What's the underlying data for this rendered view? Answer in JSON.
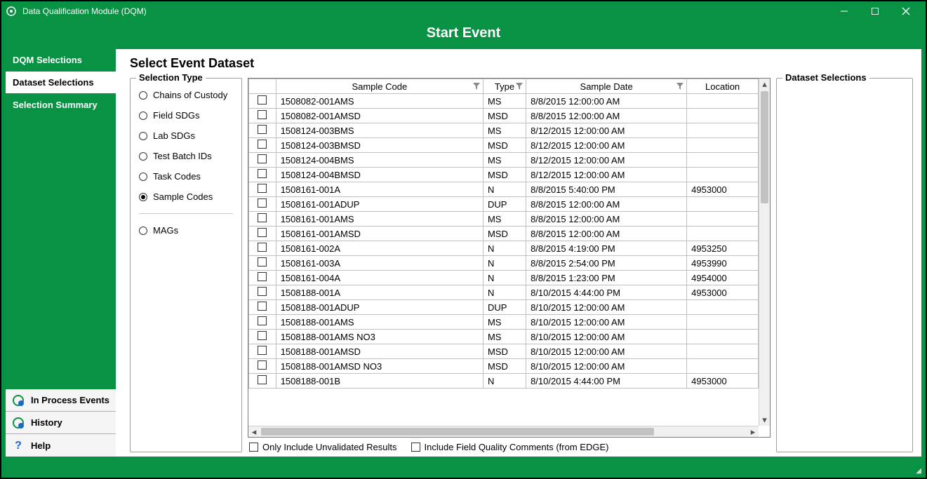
{
  "window": {
    "title": "Data Qualification Module (DQM)"
  },
  "heading": "Start Event",
  "sidebar": {
    "top": [
      {
        "label": "DQM Selections",
        "active": false
      },
      {
        "label": "Dataset Selections",
        "active": true
      },
      {
        "label": "Selection Summary",
        "active": false
      }
    ],
    "bottom": [
      {
        "label": "In Process Events",
        "icon": "events-icon"
      },
      {
        "label": "History",
        "icon": "history-icon"
      },
      {
        "label": "Help",
        "icon": "help-icon"
      }
    ]
  },
  "page_title": "Select Event Dataset",
  "selection_type": {
    "legend": "Selection Type",
    "groups": [
      [
        {
          "label": "Chains of Custody",
          "selected": false
        },
        {
          "label": "Field SDGs",
          "selected": false
        },
        {
          "label": "Lab SDGs",
          "selected": false
        },
        {
          "label": "Test Batch IDs",
          "selected": false
        },
        {
          "label": "Task Codes",
          "selected": false
        },
        {
          "label": "Sample Codes",
          "selected": true
        }
      ],
      [
        {
          "label": "MAGs",
          "selected": false
        }
      ]
    ]
  },
  "grid": {
    "columns": [
      {
        "key": "check",
        "label": "",
        "filter": false
      },
      {
        "key": "code",
        "label": "Sample Code",
        "filter": true
      },
      {
        "key": "type",
        "label": "Type",
        "filter": true
      },
      {
        "key": "date",
        "label": "Sample Date",
        "filter": true
      },
      {
        "key": "loc",
        "label": "Location",
        "filter": false
      }
    ],
    "rows": [
      {
        "code": "1508082-001AMS",
        "type": "MS",
        "date": "8/8/2015 12:00:00 AM",
        "loc": ""
      },
      {
        "code": "1508082-001AMSD",
        "type": "MSD",
        "date": "8/8/2015 12:00:00 AM",
        "loc": ""
      },
      {
        "code": "1508124-003BMS",
        "type": "MS",
        "date": "8/12/2015 12:00:00 AM",
        "loc": ""
      },
      {
        "code": "1508124-003BMSD",
        "type": "MSD",
        "date": "8/12/2015 12:00:00 AM",
        "loc": ""
      },
      {
        "code": "1508124-004BMS",
        "type": "MS",
        "date": "8/12/2015 12:00:00 AM",
        "loc": ""
      },
      {
        "code": "1508124-004BMSD",
        "type": "MSD",
        "date": "8/12/2015 12:00:00 AM",
        "loc": ""
      },
      {
        "code": "1508161-001A",
        "type": "N",
        "date": "8/8/2015 5:40:00 PM",
        "loc": "4953000"
      },
      {
        "code": "1508161-001ADUP",
        "type": "DUP",
        "date": "8/8/2015 12:00:00 AM",
        "loc": ""
      },
      {
        "code": "1508161-001AMS",
        "type": "MS",
        "date": "8/8/2015 12:00:00 AM",
        "loc": ""
      },
      {
        "code": "1508161-001AMSD",
        "type": "MSD",
        "date": "8/8/2015 12:00:00 AM",
        "loc": ""
      },
      {
        "code": "1508161-002A",
        "type": "N",
        "date": "8/8/2015 4:19:00 PM",
        "loc": "4953250"
      },
      {
        "code": "1508161-003A",
        "type": "N",
        "date": "8/8/2015 2:54:00 PM",
        "loc": "4953990"
      },
      {
        "code": "1508161-004A",
        "type": "N",
        "date": "8/8/2015 1:23:00 PM",
        "loc": "4954000"
      },
      {
        "code": "1508188-001A",
        "type": "N",
        "date": "8/10/2015 4:44:00 PM",
        "loc": "4953000"
      },
      {
        "code": "1508188-001ADUP",
        "type": "DUP",
        "date": "8/10/2015 12:00:00 AM",
        "loc": ""
      },
      {
        "code": "1508188-001AMS",
        "type": "MS",
        "date": "8/10/2015 12:00:00 AM",
        "loc": ""
      },
      {
        "code": "1508188-001AMS NO3",
        "type": "MS",
        "date": "8/10/2015 12:00:00 AM",
        "loc": ""
      },
      {
        "code": "1508188-001AMSD",
        "type": "MSD",
        "date": "8/10/2015 12:00:00 AM",
        "loc": ""
      },
      {
        "code": "1508188-001AMSD NO3",
        "type": "MSD",
        "date": "8/10/2015 12:00:00 AM",
        "loc": ""
      },
      {
        "code": "1508188-001B",
        "type": "N",
        "date": "8/10/2015 4:44:00 PM",
        "loc": "4953000"
      }
    ]
  },
  "options": {
    "only_unvalidated": "Only Include Unvalidated Results",
    "include_field_quality": "Include Field Quality Comments (from EDGE)"
  },
  "dataset_selections": {
    "legend": "Dataset Selections"
  }
}
